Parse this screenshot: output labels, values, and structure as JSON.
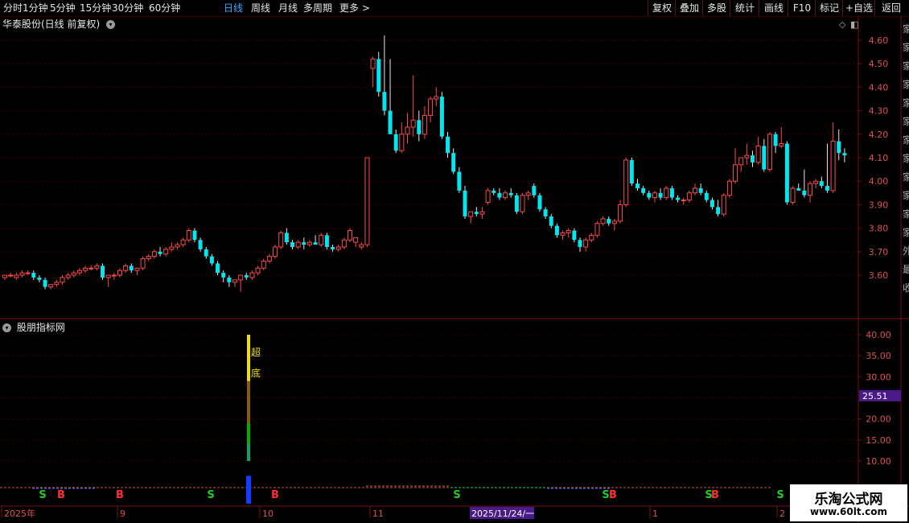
{
  "toolbar": {
    "periods": [
      "分时",
      "1分钟",
      "5分钟",
      "15分钟",
      "30分钟",
      "60分钟",
      "日线",
      "周线",
      "月线",
      "多周期",
      "更多 >"
    ],
    "active_period": "日线",
    "actions": [
      "复权",
      "叠加",
      "多股",
      "统计",
      "画线",
      "F10",
      "标记",
      "+自选",
      "返回"
    ]
  },
  "main_chart": {
    "title": "华泰股份(日线 前复权)",
    "price_ticks": [
      "4.60",
      "4.50",
      "4.40",
      "4.30",
      "4.20",
      "4.10",
      "4.00",
      "3.90",
      "3.80",
      "3.70",
      "3.60"
    ],
    "right_strip": [
      "家",
      "家",
      "家",
      "家",
      "家",
      "家",
      "家",
      "家",
      "家",
      "家",
      "家",
      "家",
      "外",
      "最",
      "收"
    ]
  },
  "indicator": {
    "title": "股朋指标网",
    "ticks": [
      "40.00",
      "35.00",
      "30.00",
      "25.00",
      "20.00",
      "15.00",
      "10.00"
    ],
    "current_value": "25.51",
    "signal_text": [
      "超",
      "底"
    ],
    "signals": [
      {
        "label": "S",
        "color": "#22cc22"
      },
      {
        "label": "B",
        "color": "#ff3030"
      },
      {
        "label": "B",
        "color": "#ff3030"
      },
      {
        "label": "S",
        "color": "#22cc22"
      },
      {
        "label": "B",
        "color": "#ff3030"
      },
      {
        "label": "S",
        "color": "#22cc22"
      },
      {
        "label": "S",
        "color": "#22cc22"
      },
      {
        "label": "B",
        "color": "#ff3030"
      },
      {
        "label": "S",
        "color": "#22cc22"
      },
      {
        "label": "B",
        "color": "#ff3030"
      },
      {
        "label": "S",
        "color": "#22cc22"
      }
    ]
  },
  "time_axis": {
    "labels": [
      "2025年",
      "9",
      "10",
      "11",
      "1",
      "2"
    ],
    "cursor_date": "2025/11/24/一"
  },
  "watermark": {
    "name": "乐淘公式网",
    "url": "www.60lt.com"
  },
  "colors": {
    "up": "#ff4a4a",
    "down": "#00e5ee",
    "grid": "#3a0000",
    "axis": "#7a1010",
    "active_tab": "#3ea8ff",
    "value_box": "#4a1a8a"
  },
  "chart_data": {
    "type": "candlestick",
    "ylim": [
      3.52,
      4.64
    ],
    "candles": [
      [
        3.59,
        3.6,
        3.58,
        3.6
      ],
      [
        3.6,
        3.61,
        3.59,
        3.6
      ],
      [
        3.59,
        3.61,
        3.58,
        3.6
      ],
      [
        3.6,
        3.62,
        3.59,
        3.61
      ],
      [
        3.61,
        3.62,
        3.6,
        3.61
      ],
      [
        3.61,
        3.62,
        3.58,
        3.59
      ],
      [
        3.59,
        3.6,
        3.57,
        3.58
      ],
      [
        3.58,
        3.59,
        3.54,
        3.55
      ],
      [
        3.55,
        3.56,
        3.54,
        3.56
      ],
      [
        3.56,
        3.58,
        3.55,
        3.57
      ],
      [
        3.57,
        3.6,
        3.56,
        3.59
      ],
      [
        3.59,
        3.61,
        3.58,
        3.6
      ],
      [
        3.6,
        3.62,
        3.59,
        3.61
      ],
      [
        3.61,
        3.63,
        3.6,
        3.62
      ],
      [
        3.62,
        3.64,
        3.61,
        3.63
      ],
      [
        3.63,
        3.64,
        3.62,
        3.63
      ],
      [
        3.63,
        3.65,
        3.62,
        3.64
      ],
      [
        3.64,
        3.65,
        3.58,
        3.59
      ],
      [
        3.59,
        3.6,
        3.55,
        3.6
      ],
      [
        3.6,
        3.61,
        3.58,
        3.6
      ],
      [
        3.6,
        3.63,
        3.59,
        3.62
      ],
      [
        3.62,
        3.65,
        3.61,
        3.64
      ],
      [
        3.64,
        3.65,
        3.61,
        3.62
      ],
      [
        3.62,
        3.63,
        3.6,
        3.63
      ],
      [
        3.63,
        3.68,
        3.62,
        3.67
      ],
      [
        3.67,
        3.69,
        3.66,
        3.68
      ],
      [
        3.68,
        3.71,
        3.67,
        3.7
      ],
      [
        3.7,
        3.72,
        3.68,
        3.69
      ],
      [
        3.69,
        3.72,
        3.68,
        3.71
      ],
      [
        3.71,
        3.74,
        3.7,
        3.72
      ],
      [
        3.72,
        3.74,
        3.71,
        3.73
      ],
      [
        3.73,
        3.76,
        3.72,
        3.75
      ],
      [
        3.75,
        3.8,
        3.74,
        3.79
      ],
      [
        3.79,
        3.8,
        3.74,
        3.75
      ],
      [
        3.75,
        3.76,
        3.7,
        3.71
      ],
      [
        3.71,
        3.72,
        3.67,
        3.68
      ],
      [
        3.68,
        3.69,
        3.64,
        3.65
      ],
      [
        3.65,
        3.66,
        3.6,
        3.61
      ],
      [
        3.61,
        3.62,
        3.57,
        3.59
      ],
      [
        3.59,
        3.6,
        3.55,
        3.57
      ],
      [
        3.57,
        3.58,
        3.55,
        3.58
      ],
      [
        3.58,
        3.6,
        3.53,
        3.6
      ],
      [
        3.6,
        3.61,
        3.58,
        3.59
      ],
      [
        3.59,
        3.62,
        3.58,
        3.61
      ],
      [
        3.61,
        3.64,
        3.6,
        3.63
      ],
      [
        3.63,
        3.67,
        3.62,
        3.66
      ],
      [
        3.66,
        3.69,
        3.65,
        3.68
      ],
      [
        3.68,
        3.73,
        3.67,
        3.72
      ],
      [
        3.72,
        3.79,
        3.71,
        3.78
      ],
      [
        3.78,
        3.8,
        3.73,
        3.74
      ],
      [
        3.74,
        3.75,
        3.71,
        3.72
      ],
      [
        3.72,
        3.75,
        3.71,
        3.74
      ],
      [
        3.74,
        3.76,
        3.71,
        3.73
      ],
      [
        3.73,
        3.75,
        3.72,
        3.74
      ],
      [
        3.74,
        3.77,
        3.73,
        3.73
      ],
      [
        3.73,
        3.78,
        3.72,
        3.77
      ],
      [
        3.77,
        3.78,
        3.71,
        3.72
      ],
      [
        3.72,
        3.73,
        3.7,
        3.71
      ],
      [
        3.71,
        3.73,
        3.7,
        3.72
      ],
      [
        3.72,
        3.76,
        3.71,
        3.75
      ],
      [
        3.75,
        3.8,
        3.74,
        3.79
      ],
      [
        3.74,
        3.76,
        3.72,
        3.76
      ],
      [
        3.72,
        3.74,
        3.71,
        3.73
      ],
      [
        3.73,
        4.1,
        3.72,
        4.1
      ],
      [
        4.48,
        4.53,
        4.4,
        4.52
      ],
      [
        4.52,
        4.55,
        4.36,
        4.38
      ],
      [
        4.38,
        4.62,
        4.28,
        4.3
      ],
      [
        4.3,
        4.52,
        4.24,
        4.2
      ],
      [
        4.2,
        4.22,
        4.12,
        4.13
      ],
      [
        4.13,
        4.25,
        4.12,
        4.2
      ],
      [
        4.2,
        4.29,
        4.16,
        4.23
      ],
      [
        4.23,
        4.45,
        4.19,
        4.26
      ],
      [
        4.26,
        4.3,
        4.17,
        4.2
      ],
      [
        4.2,
        4.32,
        4.18,
        4.28
      ],
      [
        4.28,
        4.36,
        4.25,
        4.35
      ],
      [
        4.35,
        4.4,
        4.32,
        4.36
      ],
      [
        4.36,
        4.38,
        4.18,
        4.19
      ],
      [
        4.19,
        4.21,
        4.1,
        4.12
      ],
      [
        4.12,
        4.14,
        4.03,
        4.04
      ],
      [
        4.04,
        4.06,
        3.95,
        3.96
      ],
      [
        3.96,
        3.98,
        3.84,
        3.85
      ],
      [
        3.85,
        3.87,
        3.82,
        3.87
      ],
      [
        3.87,
        3.89,
        3.85,
        3.86
      ],
      [
        3.86,
        3.89,
        3.84,
        3.87
      ],
      [
        3.91,
        3.97,
        3.9,
        3.96
      ],
      [
        3.96,
        3.97,
        3.94,
        3.95
      ],
      [
        3.95,
        3.97,
        3.92,
        3.93
      ],
      [
        3.93,
        3.96,
        3.92,
        3.95
      ],
      [
        3.95,
        3.97,
        3.93,
        3.94
      ],
      [
        3.94,
        3.95,
        3.86,
        3.87
      ],
      [
        3.87,
        3.95,
        3.86,
        3.94
      ],
      [
        3.94,
        3.96,
        3.92,
        3.95
      ],
      [
        3.98,
        3.99,
        3.93,
        3.94
      ],
      [
        3.94,
        3.95,
        3.87,
        3.88
      ],
      [
        3.88,
        3.89,
        3.84,
        3.85
      ],
      [
        3.85,
        3.86,
        3.8,
        3.81
      ],
      [
        3.81,
        3.82,
        3.76,
        3.77
      ],
      [
        3.77,
        3.79,
        3.75,
        3.78
      ],
      [
        3.78,
        3.8,
        3.76,
        3.79
      ],
      [
        3.79,
        3.8,
        3.74,
        3.75
      ],
      [
        3.75,
        3.76,
        3.7,
        3.72
      ],
      [
        3.72,
        3.76,
        3.7,
        3.75
      ],
      [
        3.75,
        3.78,
        3.74,
        3.77
      ],
      [
        3.77,
        3.83,
        3.76,
        3.82
      ],
      [
        3.82,
        3.85,
        3.81,
        3.84
      ],
      [
        3.84,
        3.85,
        3.81,
        3.82
      ],
      [
        3.82,
        3.84,
        3.79,
        3.83
      ],
      [
        3.83,
        3.92,
        3.82,
        3.9
      ],
      [
        3.9,
        4.1,
        3.89,
        4.09
      ],
      [
        4.09,
        4.1,
        3.98,
        3.99
      ],
      [
        3.99,
        4.01,
        3.96,
        3.97
      ],
      [
        3.97,
        3.98,
        3.94,
        3.95
      ],
      [
        3.95,
        3.96,
        3.92,
        3.93
      ],
      [
        3.93,
        3.96,
        3.91,
        3.95
      ],
      [
        3.95,
        3.97,
        3.92,
        3.93
      ],
      [
        3.93,
        3.98,
        3.92,
        3.97
      ],
      [
        3.97,
        3.98,
        3.92,
        3.93
      ],
      [
        3.93,
        3.94,
        3.91,
        3.92
      ],
      [
        3.92,
        3.93,
        3.9,
        3.92
      ],
      [
        3.92,
        3.96,
        3.91,
        3.95
      ],
      [
        3.95,
        3.99,
        3.94,
        3.97
      ],
      [
        3.97,
        3.99,
        3.94,
        3.95
      ],
      [
        3.95,
        3.96,
        3.91,
        3.92
      ],
      [
        3.92,
        3.93,
        3.88,
        3.89
      ],
      [
        3.89,
        3.92,
        3.85,
        3.86
      ],
      [
        3.86,
        3.95,
        3.85,
        3.94
      ],
      [
        3.94,
        4.01,
        3.93,
        4.0
      ],
      [
        4.0,
        4.14,
        3.99,
        4.07
      ],
      [
        4.07,
        4.1,
        4.04,
        4.1
      ],
      [
        4.1,
        4.16,
        4.07,
        4.11
      ],
      [
        4.11,
        4.13,
        4.06,
        4.08
      ],
      [
        4.08,
        4.19,
        4.07,
        4.15
      ],
      [
        4.15,
        4.18,
        4.04,
        4.05
      ],
      [
        4.05,
        4.21,
        4.04,
        4.2
      ],
      [
        4.2,
        4.21,
        4.12,
        4.15
      ],
      [
        4.15,
        4.23,
        4.14,
        4.16
      ],
      [
        4.16,
        4.17,
        3.9,
        3.91
      ],
      [
        3.91,
        3.98,
        3.9,
        3.97
      ],
      [
        3.97,
        3.99,
        3.96,
        3.96
      ],
      [
        3.96,
        4.05,
        3.93,
        3.94
      ],
      [
        3.94,
        4.0,
        3.91,
        3.99
      ],
      [
        3.99,
        4.01,
        3.97,
        4.0
      ],
      [
        4.0,
        4.02,
        3.97,
        3.98
      ],
      [
        3.98,
        4.16,
        3.95,
        3.96
      ],
      [
        3.96,
        4.25,
        3.95,
        4.17
      ],
      [
        4.17,
        4.22,
        4.09,
        4.12
      ],
      [
        4.12,
        4.14,
        4.08,
        4.11
      ]
    ]
  }
}
